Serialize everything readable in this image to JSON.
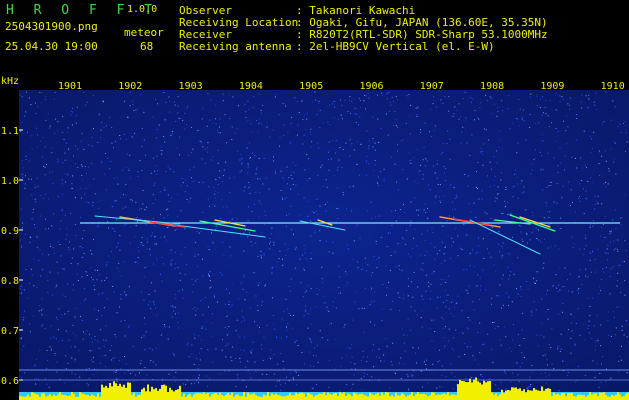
{
  "header": {
    "app_logo": "H R O F F T",
    "version": "1.0.0",
    "filename": "2504301900.png",
    "meteor_label": "meteor",
    "datetime": "25.04.30 19:00",
    "meteor_count": "68",
    "info": [
      {
        "key": "Observer",
        "value": ": Takanori Kawachi"
      },
      {
        "key": "Receiving Location",
        "value": ": Ogaki, Gifu, JAPAN (136.60E, 35.35N)"
      },
      {
        "key": "Receiver",
        "value": ": R820T2(RTL-SDR) SDR-Sharp 53.1000MHz"
      },
      {
        "key": "Receiving antenna",
        "value": ": 2el-HB9CV Vertical (el. E-W)"
      }
    ]
  },
  "colors": {
    "label_yellow": "#f0f000",
    "label_green": "#3cdc3c",
    "background_blue": "#0a1a7a",
    "trace_cyan": "#40e0ff"
  },
  "spectrogram": {
    "y_unit": "kHz",
    "y_ticks": [
      "1.1",
      "1.0",
      "0.9",
      "0.8",
      "0.7",
      "0.6"
    ],
    "x_ticks": [
      "1901",
      "1902",
      "1903",
      "1904",
      "1905",
      "1906",
      "1907",
      "1908",
      "1909",
      "1910"
    ]
  }
}
